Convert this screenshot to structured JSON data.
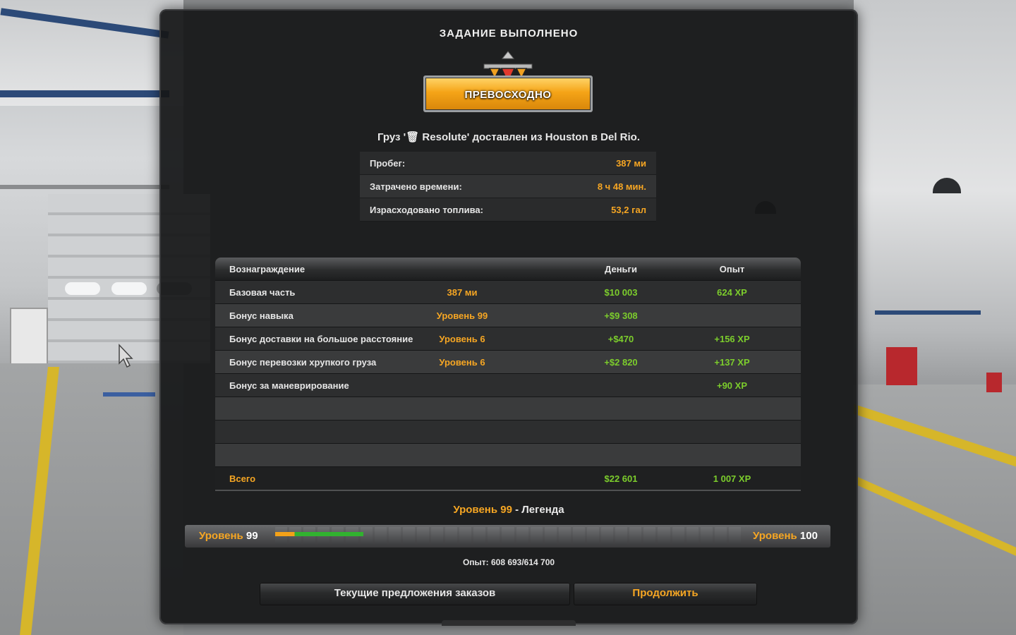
{
  "header": {
    "title": "ЗАДАНИЕ ВЫПОЛНЕНО"
  },
  "rating": {
    "label": "ПРЕВОСХОДНО",
    "emblem_icon": "triangle-medal-icon",
    "color": "#f5a417"
  },
  "cargo": {
    "text": "Груз '🗑 Resolute' доставлен из Houston в Del Rio."
  },
  "stats": [
    {
      "label": "Пробег:",
      "value": "387 ми"
    },
    {
      "label": "Затрачено времени:",
      "value": "8 ч 48 мин."
    },
    {
      "label": "Израсходовано топлива:",
      "value": "53,2 гал"
    }
  ],
  "rewards": {
    "headers": {
      "name": "Вознаграждение",
      "money": "Деньги",
      "xp": "Опыт"
    },
    "rows": [
      {
        "name": "Базовая часть",
        "detail": "387 ми",
        "money": "$10 003",
        "xp": "624 XP"
      },
      {
        "name": "Бонус навыка",
        "detail": "Уровень 99",
        "money": "+$9 308",
        "xp": ""
      },
      {
        "name": "Бонус доставки на большое расстояние",
        "detail": "Уровень 6",
        "money": "+$470",
        "xp": "+156 XP"
      },
      {
        "name": "Бонус перевозки хрупкого груза",
        "detail": "Уровень 6",
        "money": "+$2 820",
        "xp": "+137 XP"
      },
      {
        "name": "Бонус за маневрирование",
        "detail": "",
        "money": "",
        "xp": "+90 XP"
      },
      {
        "name": "",
        "detail": "",
        "money": "",
        "xp": ""
      },
      {
        "name": "",
        "detail": "",
        "money": "",
        "xp": ""
      },
      {
        "name": "",
        "detail": "",
        "money": "",
        "xp": ""
      }
    ],
    "total": {
      "name": "Всего",
      "money": "$22 601",
      "xp": "1 007 XP"
    }
  },
  "level": {
    "title_word": "Уровень",
    "title_number": "99",
    "title_suffix": " - Легенда",
    "current_word": "Уровень",
    "current_number": "99",
    "next_word": "Уровень",
    "next_number": "100",
    "progress_fraction": 0.19,
    "old_fraction_share": 0.22,
    "segments": 33,
    "xp_text": "Опыт: 608 693/614 700"
  },
  "buttons": {
    "offers": "Текущие предложения заказов",
    "continue": "Продолжить"
  },
  "colors": {
    "accent": "#f6a623",
    "positive": "#7ccd2c",
    "panel": "#161718"
  }
}
